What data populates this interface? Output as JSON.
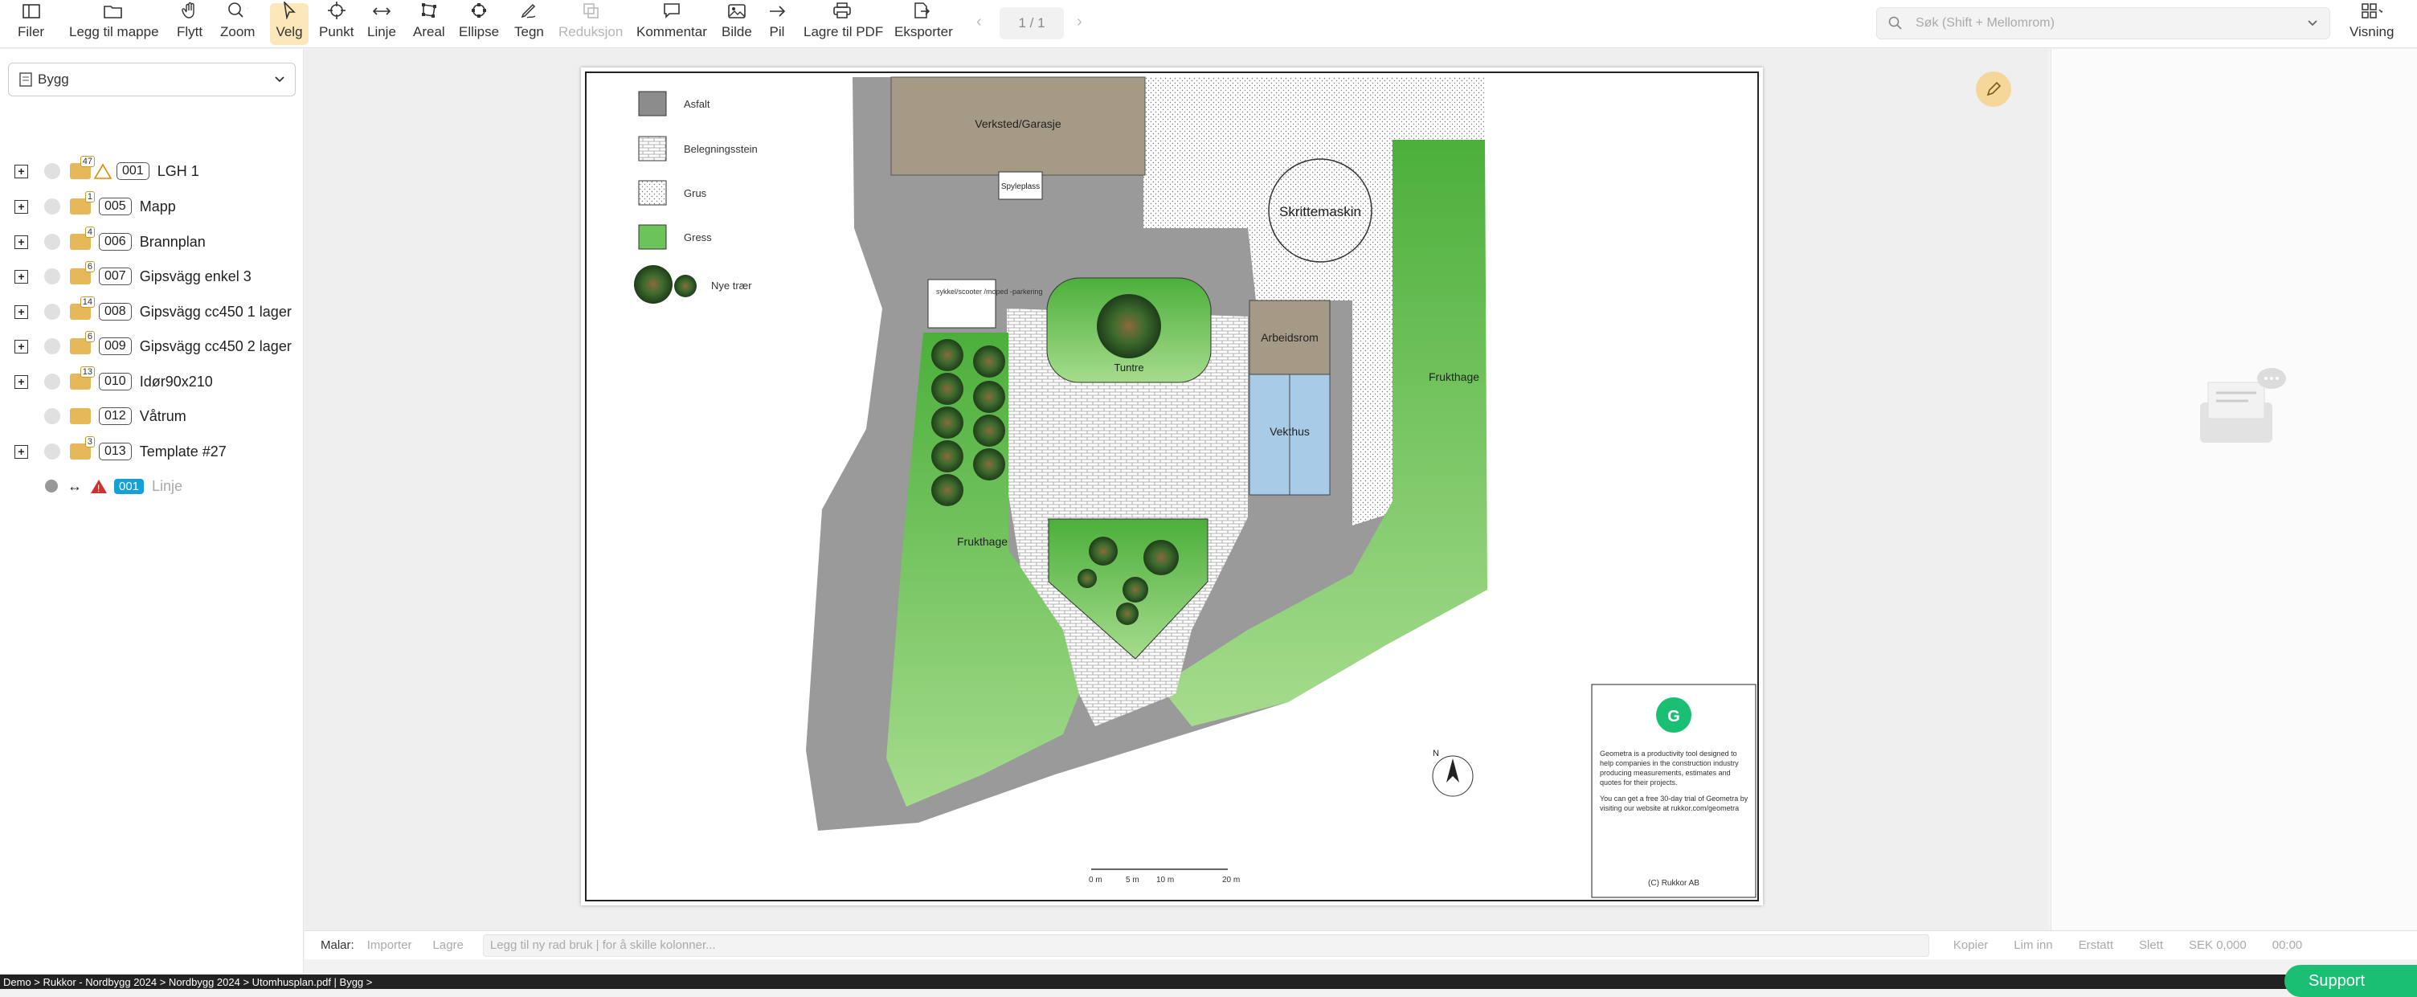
{
  "toolbar": {
    "items": [
      {
        "label": "Filer",
        "icon": "file-icon"
      },
      {
        "label": "Legg til mappe",
        "icon": "folder-add-icon"
      },
      {
        "label": "Flytt",
        "icon": "hand-icon"
      },
      {
        "label": "Zoom",
        "icon": "zoom-icon"
      },
      {
        "label": "Velg",
        "icon": "cursor-icon"
      },
      {
        "label": "Punkt",
        "icon": "crosshair-icon"
      },
      {
        "label": "Linje",
        "icon": "line-icon"
      },
      {
        "label": "Areal",
        "icon": "area-icon"
      },
      {
        "label": "Ellipse",
        "icon": "ellipse-icon"
      },
      {
        "label": "Tegn",
        "icon": "draw-icon"
      },
      {
        "label": "Reduksjon",
        "icon": "reduction-icon"
      },
      {
        "label": "Kommentar",
        "icon": "comment-icon"
      },
      {
        "label": "Bilde",
        "icon": "image-icon"
      },
      {
        "label": "Pil",
        "icon": "arrow-icon"
      },
      {
        "label": "Lagre til PDF",
        "icon": "printer-icon"
      },
      {
        "label": "Eksporter",
        "icon": "export-icon"
      }
    ],
    "page_indicator": "1 / 1",
    "search_placeholder": "Søk (Shift + Mellomrom)",
    "view_label": "Visning"
  },
  "sidebar": {
    "selector": "Bygg",
    "items": [
      {
        "code": "001",
        "name": "LGH 1",
        "count": "47",
        "warning": true
      },
      {
        "code": "005",
        "name": "Mapp",
        "count": "1"
      },
      {
        "code": "006",
        "name": "Brannplan",
        "count": "4"
      },
      {
        "code": "007",
        "name": "Gipsvägg enkel 3",
        "count": "6"
      },
      {
        "code": "008",
        "name": "Gipsvägg cc450 1 lager",
        "count": "14"
      },
      {
        "code": "009",
        "name": "Gipsvägg cc450 2 lager",
        "count": "6"
      },
      {
        "code": "010",
        "name": "Idør90x210",
        "count": "13"
      },
      {
        "code": "012",
        "name": "Våtrum",
        "count": ""
      },
      {
        "code": "013",
        "name": "Template #27",
        "count": "3"
      }
    ],
    "line_item": {
      "code": "001",
      "name": "Linje"
    }
  },
  "drawing": {
    "legend": [
      "Asfalt",
      "Belegningsstein",
      "Grus",
      "Gress",
      "Nye trær"
    ],
    "labels": {
      "garage": "Verksted/Garasje",
      "wash": "Spyleplass",
      "machine": "Skrittemaskin",
      "tree": "Tuntre",
      "work": "Arbeidsrom",
      "greenhouse": "Vekthus",
      "orchard1": "Frukthage",
      "orchard2": "Frukthage",
      "bike": "sykkel/scooter /moped -parkering"
    },
    "scale": [
      "0 m",
      "5 m",
      "10 m",
      "20 m"
    ],
    "logo_letter": "G",
    "info_text_1": "Geometra is a productivity tool designed to help companies in the construction industry producing measurements, estimates and quotes for their projects.",
    "info_text_2": "You can get a free 30-day trial of Geometra by visiting our website at rukkor.com/geometra",
    "copyright": "(C) Rukkor AB",
    "north": "N"
  },
  "bottom": {
    "malar": "Malar:",
    "import": "Importer",
    "save": "Lagre",
    "placeholder": "Legg til ny rad bruk | for å skille kolonner...",
    "copy": "Kopier",
    "paste": "Lim inn",
    "replace": "Erstatt",
    "delete": "Slett",
    "price": "SEK 0,000",
    "time": "00:00"
  },
  "status_bar": "Demo > Rukkor - Nordbygg 2024 > Nordbygg 2024 > Utomhusplan.pdf  |  Bygg >",
  "support": "Support"
}
